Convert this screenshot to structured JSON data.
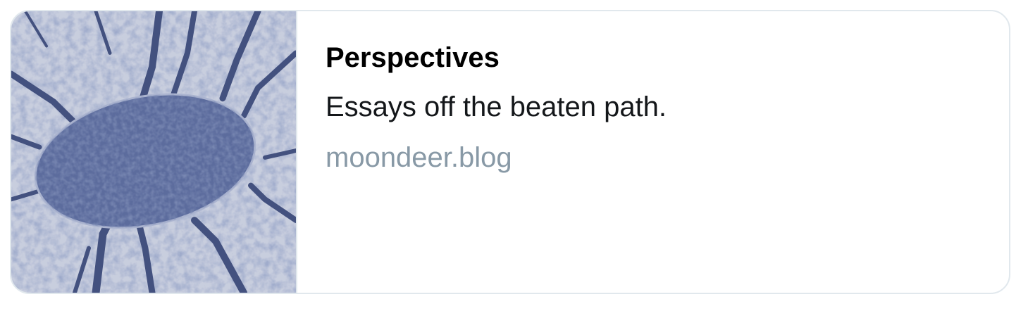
{
  "card": {
    "title": "Perspectives",
    "description": "Essays off the beaten path.",
    "domain": "moondeer.blog",
    "thumbnail_icon": "forest-canopy-image"
  },
  "colors": {
    "border": "#e1e8ed",
    "title": "#000000",
    "description": "#14171a",
    "domain": "#8899a6",
    "image_tint": "#5a6a9c"
  }
}
